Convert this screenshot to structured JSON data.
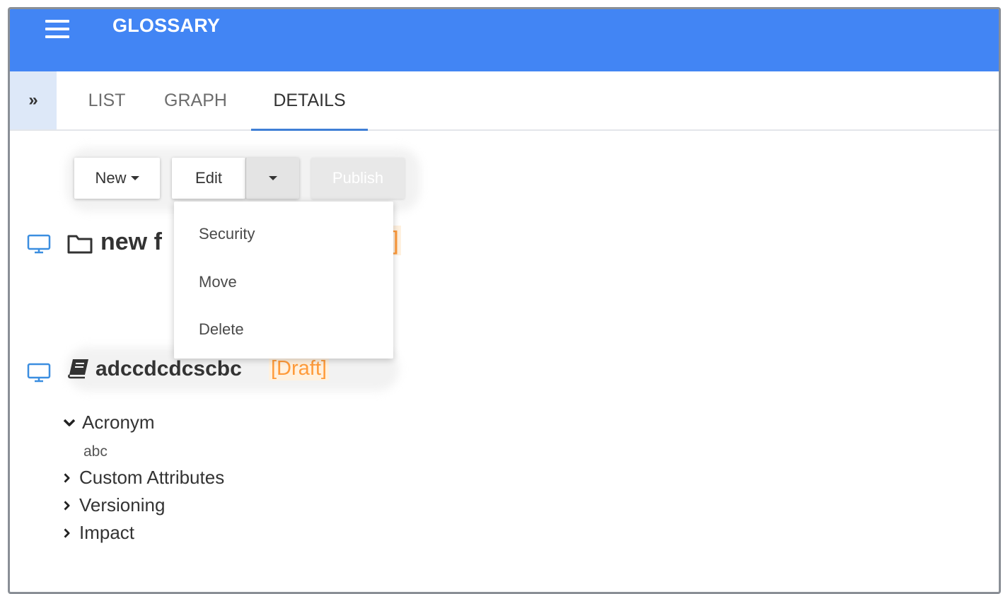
{
  "header": {
    "title": "GLOSSARY"
  },
  "expander": {
    "label": "»"
  },
  "tabs": [
    {
      "label": "LIST",
      "active": false
    },
    {
      "label": "GRAPH",
      "active": false
    },
    {
      "label": "DETAILS",
      "active": true
    }
  ],
  "toolbar": {
    "new_label": "New",
    "edit_label": "Edit",
    "publish_label": "Publish"
  },
  "edit_menu": {
    "items": [
      "Security",
      "Move",
      "Delete"
    ]
  },
  "folder_item": {
    "title_visible": "new f",
    "status_partial": "]"
  },
  "glossary_item": {
    "title": "adccdcdcscbc",
    "status": "[Draft]"
  },
  "sections": {
    "acronym": {
      "label": "Acronym",
      "value": "abc",
      "expanded": true
    },
    "custom_attributes": {
      "label": "Custom Attributes",
      "expanded": false
    },
    "versioning": {
      "label": "Versioning",
      "expanded": false
    },
    "impact": {
      "label": "Impact",
      "expanded": false
    }
  },
  "colors": {
    "header_bg": "#4285f4",
    "tab_underline": "#3f7fd6",
    "draft_text": "#ff9b3a",
    "draft_bg": "#fff1df",
    "monitor_icon": "#3b8ee0"
  },
  "icons": {
    "menu": "hamburger-icon",
    "expand": "double-chevron-right-icon",
    "entry": "monitor-icon",
    "folder": "folder-icon",
    "term": "book-icon",
    "expanded": "chevron-down-icon",
    "collapsed": "chevron-right-icon"
  }
}
